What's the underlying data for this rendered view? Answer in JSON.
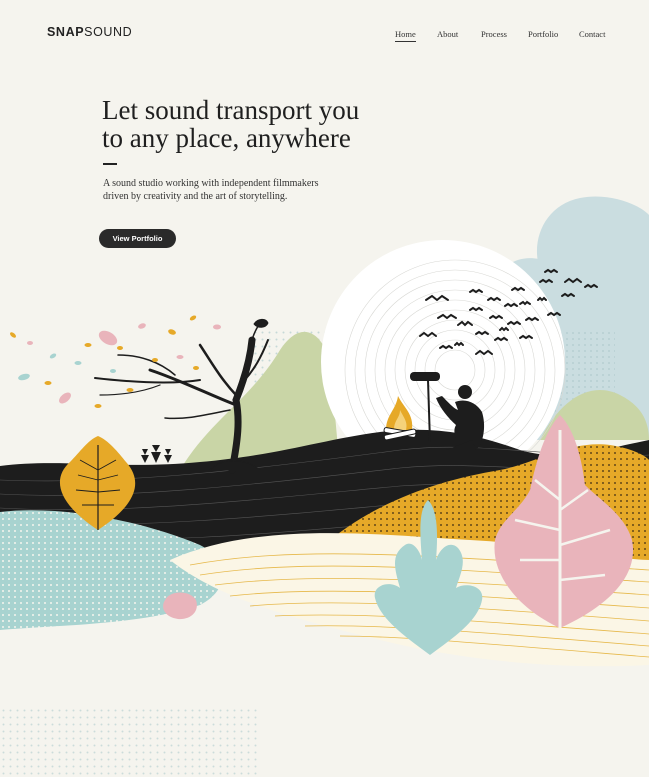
{
  "brand": {
    "logo_bold": "SNAP",
    "logo_light": "SOUND"
  },
  "nav": {
    "items": [
      {
        "label": "Home",
        "active": true
      },
      {
        "label": "About",
        "active": false
      },
      {
        "label": "Process",
        "active": false
      },
      {
        "label": "Portfolio",
        "active": false
      },
      {
        "label": "Contact",
        "active": false
      }
    ]
  },
  "hero": {
    "title_line1": "Let sound transport you",
    "title_line2": "to any place, anywhere",
    "subtitle_line1": "A sound studio working with independent filmmakers",
    "subtitle_line2": "driven by creativity and the art of storytelling.",
    "cta_label": "View Portfolio"
  },
  "colors": {
    "background": "#f5f4ee",
    "ink": "#222222",
    "mustard": "#e6a928",
    "pink": "#e9b4bb",
    "mint": "#a8d3d0",
    "sage": "#c9d5a6",
    "blue_grey": "#cadde0"
  }
}
